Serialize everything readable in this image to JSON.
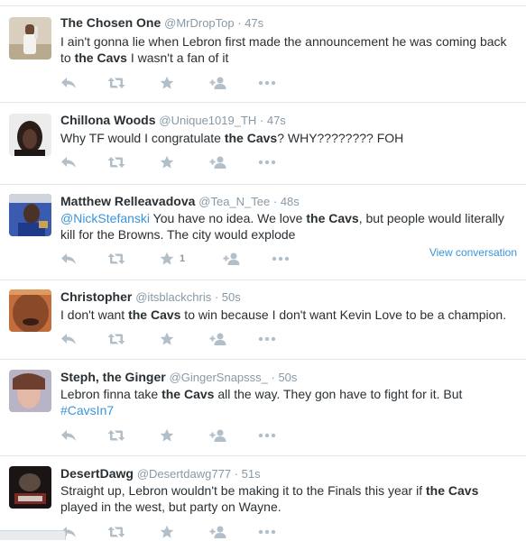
{
  "tweets": [
    {
      "fullname": "The Chosen One",
      "username": "@MrDropTop",
      "sep": " · ",
      "time": "47s",
      "segments": [
        {
          "t": "I ain't gonna lie when Lebron first made the announcement he was coming back to "
        },
        {
          "t": "the Cavs",
          "b": true
        },
        {
          "t": " I wasn't a fan of it"
        }
      ],
      "like_count": "",
      "view_conversation": ""
    },
    {
      "fullname": "Chillona Woods",
      "username": "@Unique1019_TH",
      "sep": " · ",
      "time": "47s",
      "segments": [
        {
          "t": "Why TF would I congratulate "
        },
        {
          "t": "the Cavs",
          "b": true
        },
        {
          "t": "? WHY???????? FOH"
        }
      ],
      "like_count": "",
      "view_conversation": ""
    },
    {
      "fullname": "Matthew Relleavadova",
      "username": "@Tea_N_Tee",
      "sep": " · ",
      "time": "48s",
      "segments": [
        {
          "t": "@NickStefanski",
          "link": true
        },
        {
          "t": " You have no idea. We love "
        },
        {
          "t": "the Cavs",
          "b": true
        },
        {
          "t": ", but people would literally kill for the Browns. The city would explode"
        }
      ],
      "like_count": "1",
      "view_conversation": "View conversation"
    },
    {
      "fullname": "Christopher",
      "username": "@itsblackchris",
      "sep": " · ",
      "time": "50s",
      "segments": [
        {
          "t": "I don't want "
        },
        {
          "t": "the Cavs",
          "b": true
        },
        {
          "t": " to win because I don't want Kevin Love to be a champion."
        }
      ],
      "like_count": "",
      "view_conversation": ""
    },
    {
      "fullname": "Steph, the Ginger",
      "username": "@GingerSnapsss_",
      "sep": " · ",
      "time": "50s",
      "segments": [
        {
          "t": "Lebron finna take "
        },
        {
          "t": "the Cavs",
          "b": true
        },
        {
          "t": " all the way. They gon have to fight for it. But "
        },
        {
          "t": "#CavsIn7",
          "link": true
        }
      ],
      "like_count": "",
      "view_conversation": ""
    },
    {
      "fullname": "DesertDawg",
      "username": "@Desertdawg777",
      "sep": " · ",
      "time": "51s",
      "segments": [
        {
          "t": "Straight up, Lebron wouldn't be making it to the Finals this year if "
        },
        {
          "t": "the Cavs",
          "b": true
        },
        {
          "t": " played in the west, but party on Wayne."
        }
      ],
      "like_count": "",
      "view_conversation": ""
    }
  ],
  "icons": {
    "reply": "reply-icon",
    "retweet": "retweet-icon",
    "favorite": "star-icon",
    "follow": "follow-icon",
    "more": "more-icon"
  },
  "colors": {
    "icon": "#b3bfc8",
    "link": "#3b94d9",
    "meta": "#8899a6",
    "text": "#292f33",
    "divider": "#e1e8ed"
  }
}
